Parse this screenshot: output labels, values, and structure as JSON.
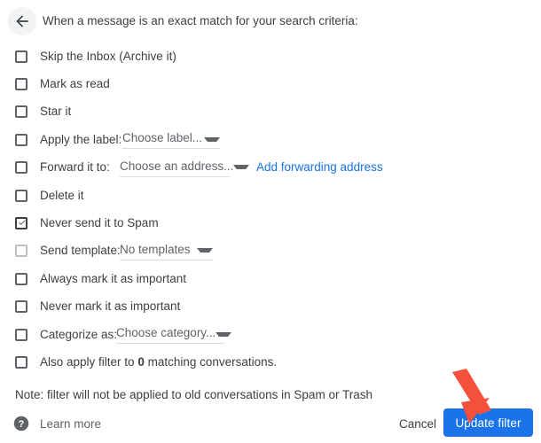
{
  "header": {
    "back_icon": "arrow-left-icon",
    "title": "When a message is an exact match for your search criteria:"
  },
  "actions": [
    {
      "label": "Skip the Inbox (Archive it)",
      "checked": false,
      "disabled": false
    },
    {
      "label": "Mark as read",
      "checked": false,
      "disabled": false
    },
    {
      "label": "Star it",
      "checked": false,
      "disabled": false
    },
    {
      "label": "Apply the label:",
      "checked": false,
      "disabled": false,
      "dropdown": "Choose label..."
    },
    {
      "label": "Forward it to:",
      "checked": false,
      "disabled": false,
      "dropdown": "Choose an address...",
      "link": "Add forwarding address"
    },
    {
      "label": "Delete it",
      "checked": false,
      "disabled": false
    },
    {
      "label": "Never send it to Spam",
      "checked": true,
      "disabled": false
    },
    {
      "label": "Send template:",
      "checked": false,
      "disabled": true,
      "dropdown": "No templates"
    },
    {
      "label": "Always mark it as important",
      "checked": false,
      "disabled": false
    },
    {
      "label": "Never mark it as important",
      "checked": false,
      "disabled": false
    },
    {
      "label": "Categorize as:",
      "checked": false,
      "disabled": false,
      "dropdown": "Choose category..."
    },
    {
      "label": "Also apply filter to 0 matching conversations.",
      "label_bold_part": "0",
      "checked": false,
      "disabled": false
    }
  ],
  "note": "Note: filter will not be applied to old conversations in Spam or Trash",
  "footer": {
    "help_icon": "help-circle-icon",
    "learn_more": "Learn more",
    "cancel": "Cancel",
    "update": "Update filter"
  },
  "annotation": {
    "arrow_color": "#f4503c",
    "points_to": "Update filter"
  },
  "colors": {
    "accent": "#1a73e8",
    "text": "#3c4043",
    "muted": "#5f6368",
    "border": "#dadce0",
    "annotation": "#f4503c"
  }
}
